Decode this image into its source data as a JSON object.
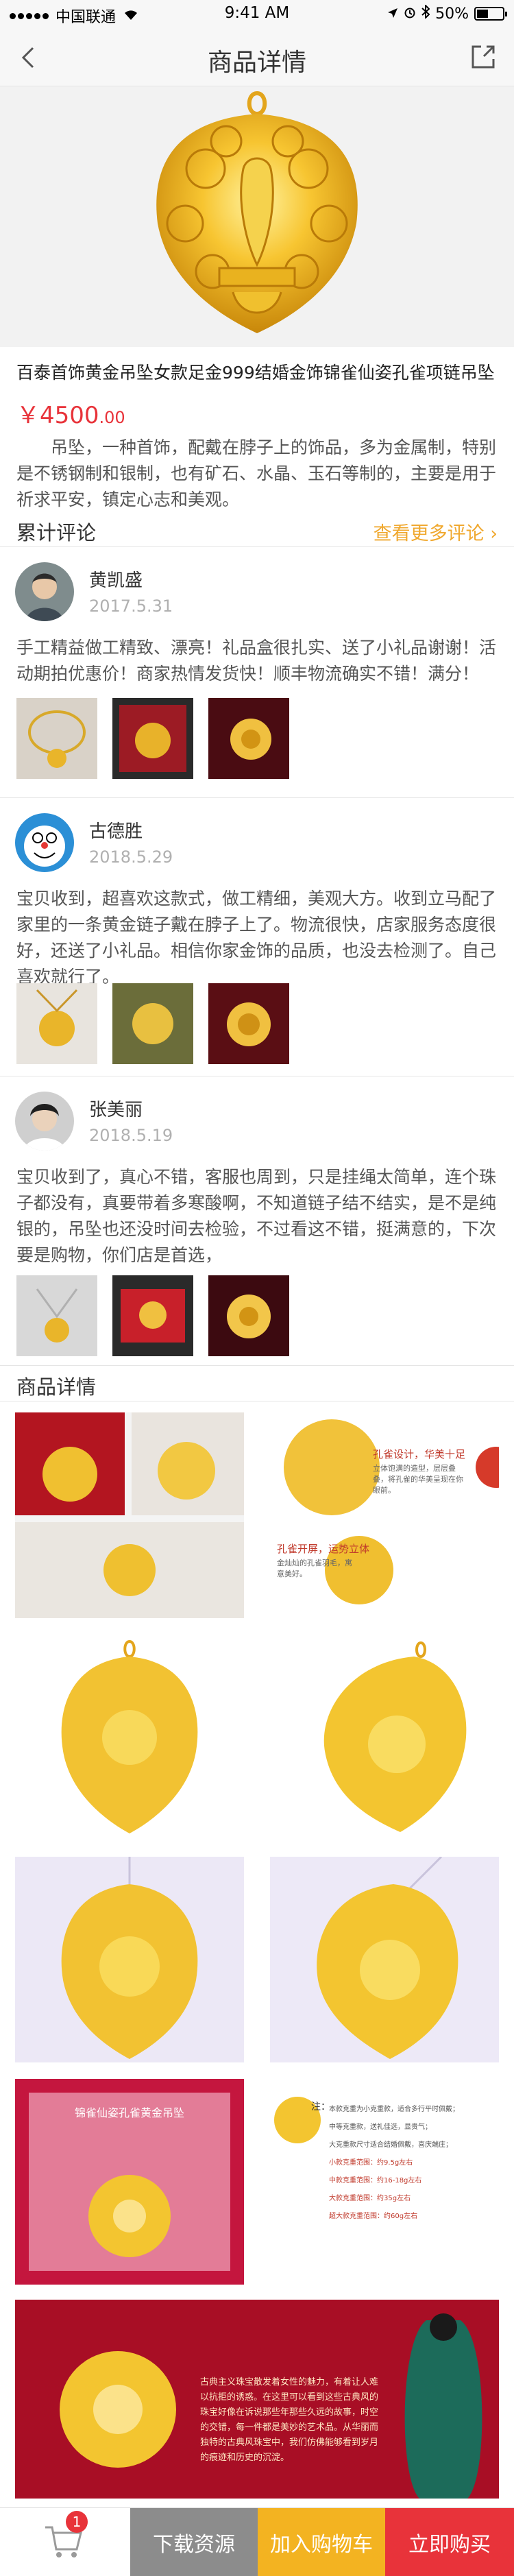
{
  "status_bar": {
    "carrier": "中国联通",
    "time": "9:41 AM",
    "battery_text": "50%",
    "battery_level": 0.5
  },
  "nav": {
    "title": "商品详情"
  },
  "product": {
    "title": "百泰首饰黄金吊坠女款足金999结婚金饰锦雀仙姿孔雀项链吊坠",
    "price_main": "￥4500",
    "price_decimal": ".00",
    "description": "吊坠，一种首饰，配戴在脖子上的饰品，多为金属制，特别是不锈钢制和银制，也有矿石、水晶、玉石等制的，主要是用于祈求平安，镇定心志和美观。"
  },
  "reviews_section": {
    "label": "累计评论",
    "more_label": "查看更多评论"
  },
  "reviews": [
    {
      "name": "黄凯盛",
      "date": "2017.5.31",
      "text": "手工精益做工精致、漂亮！礼品盒很扎实、送了小礼品谢谢！活动期拍优惠价！商家热情发货快！顺丰物流确实不错！满分！"
    },
    {
      "name": "古德胜",
      "date": "2018.5.29",
      "text": "宝贝收到，超喜欢这款式，做工精细，美观大方。收到立马配了家里的一条黄金链子戴在脖子上了。物流很快，店家服务态度很好，还送了小礼品。相信你家金饰的品质，也没去检测了。自己喜欢就行了。"
    },
    {
      "name": "张美丽",
      "date": "2018.5.19",
      "text": "宝贝收到了，真心不错，客服也周到，只是挂绳太简单，连个珠子都没有，真要带着多寒酸啊，不知道链子结不结实，是不是纯银的，吊坠也还没时间去检验，不过看这不错，挺满意的，下次要是购物，你们店是首选，"
    }
  ],
  "details_section": {
    "label": "商品详情"
  },
  "gallery_texts": {
    "design_title": "孔雀设计，华美十足",
    "design_body": "立体饱满的造型，层层叠叠，将孔雀的华美呈现在你眼前。",
    "tail_title": "孔雀开屏，运势立体",
    "tail_body": "金灿灿的孔雀羽毛，寓意美好。",
    "banner_title": "锦雀仙姿孔雀黄金吊坠",
    "note_label": "注：",
    "note_lines": [
      "本款克重为小克重款，适合多行平时佩戴；",
      "中等克重款，送礼佳选，显贵气；",
      "大克重款尺寸适合结婚佩戴，喜庆端庄；",
      "小款克重范围：约9.5g左右",
      "中款克重范围：约16-18g左右",
      "大款克重范围：约35g左右",
      "超大款克重范围：约60g左右"
    ],
    "story": "古典主义珠宝散发着女性的魅力，有着让人难以抗拒的诱惑。在这里可以看到这些古典风的珠宝好像在诉说那些年那些久远的故事，时空的交错，每一件都是美妙的艺术品。从华丽而独特的古典风珠宝中，我们仿佛能够看到岁月的痕迹和历史的沉淀。"
  },
  "bottom_bar": {
    "cart_count": "1",
    "download_label": "下载资源",
    "add_cart_label": "加入购物车",
    "buy_now_label": "立即购买"
  },
  "colors": {
    "price_red": "#e8333a",
    "more_orange": "#f0a82e",
    "gold": "#f3b321",
    "gray_button": "#8c8c8c"
  }
}
